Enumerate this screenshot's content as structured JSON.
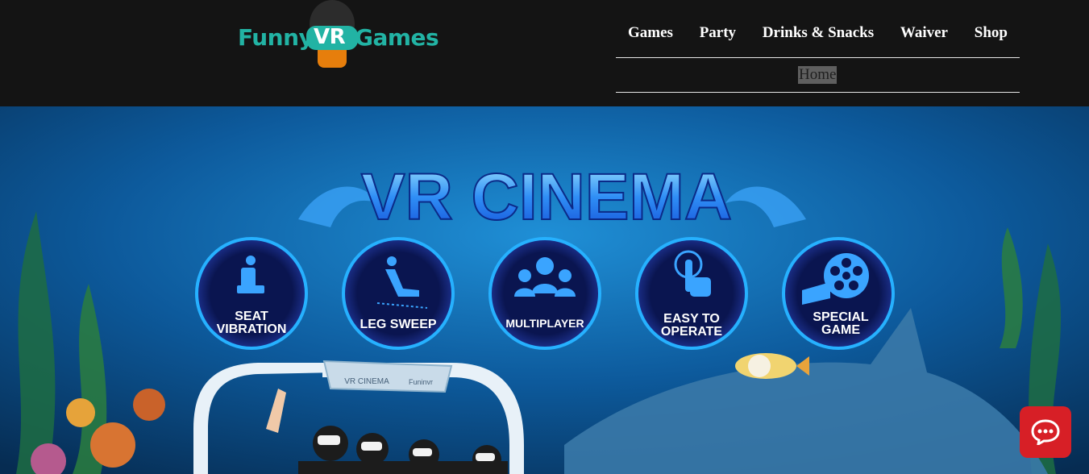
{
  "brand": {
    "logo_left": "Funny",
    "logo_middle": "VR",
    "logo_right": "Games",
    "accent_color": "#22b3a4",
    "face_color": "#e67e0c"
  },
  "nav": {
    "items": [
      {
        "label": "Games"
      },
      {
        "label": "Party"
      },
      {
        "label": "Drinks & Snacks"
      },
      {
        "label": "Waiver"
      },
      {
        "label": "Shop"
      }
    ],
    "current": {
      "label": "Home"
    }
  },
  "hero": {
    "title": "VR CINEMA",
    "features": [
      {
        "line1": "SEAT",
        "line2": "VIBRATION",
        "icon": "seat-icon"
      },
      {
        "line1": "LEG SWEEP",
        "line2": "",
        "icon": "leg-sweep-icon"
      },
      {
        "line1": "MULTIPLAYER",
        "line2": "",
        "icon": "multiplayer-icon"
      },
      {
        "line1": "EASY TO",
        "line2": "OPERATE",
        "icon": "touch-icon"
      },
      {
        "line1": "SPECIAL",
        "line2": "GAME",
        "icon": "film-reel-icon"
      }
    ],
    "machine_sign": "VR CINEMA",
    "machine_brand": "Funinvr",
    "background_color": "#0d5a9c"
  },
  "chat": {
    "icon": "chat-icon",
    "color": "#d71f26"
  }
}
